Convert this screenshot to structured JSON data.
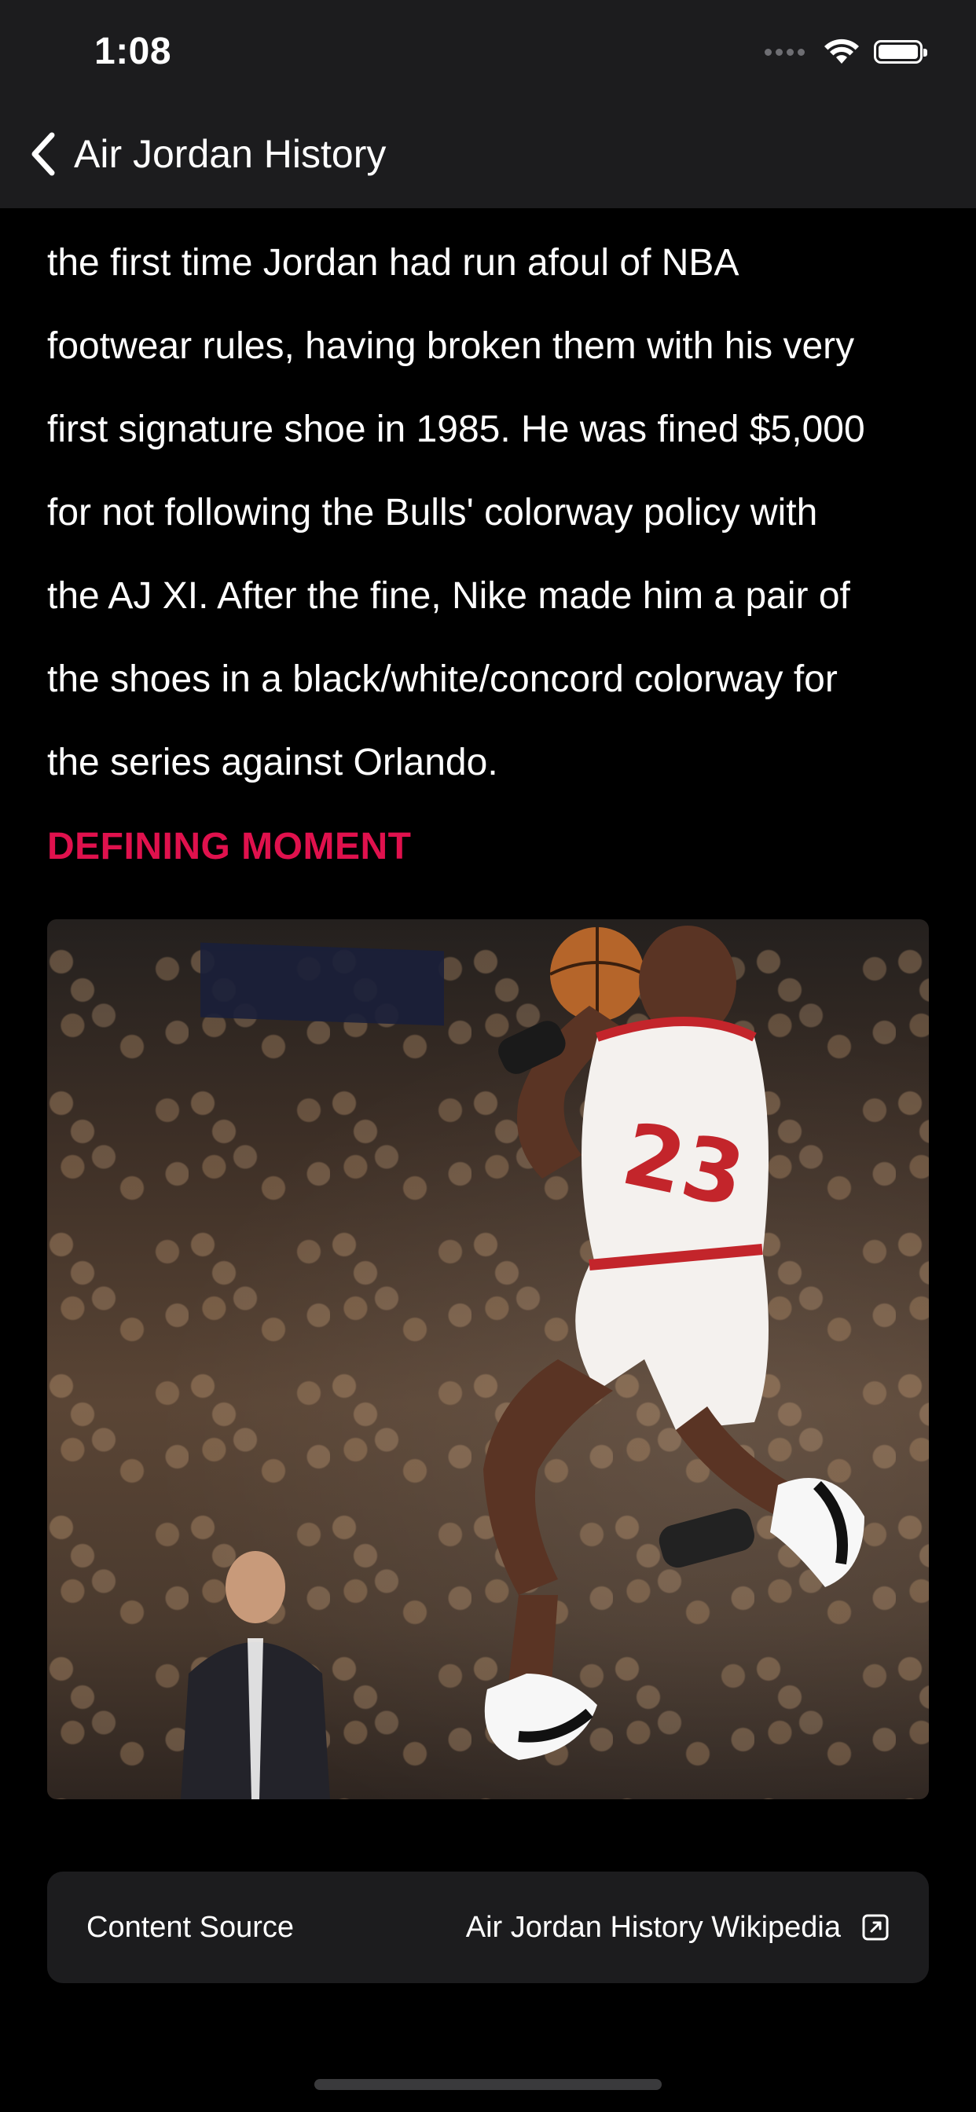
{
  "status_bar": {
    "time": "1:08"
  },
  "nav": {
    "back_icon": "chevron-left-icon",
    "title": "Air Jordan History"
  },
  "article": {
    "lines": [
      "the first time Jordan had run afoul of NBA",
      "footwear rules, having broken them with his very",
      "first signature shoe in 1985. He was fined $5,000",
      "for not following the Bulls' colorway policy with",
      "the AJ XI. After the fine, Nike made him a pair of",
      "the shoes in a black/white/concord colorway for",
      "the series against Orlando."
    ]
  },
  "section": {
    "heading": "DEFINING MOMENT",
    "heading_color": "#e0114d"
  },
  "source_card": {
    "label": "Content Source",
    "link_text": "Air Jordan History Wikipedia",
    "link_icon": "external-link-icon"
  },
  "colors": {
    "background": "#000000",
    "header": "#1c1c1e",
    "card": "#1c1c1e",
    "accent": "#e0114d"
  }
}
